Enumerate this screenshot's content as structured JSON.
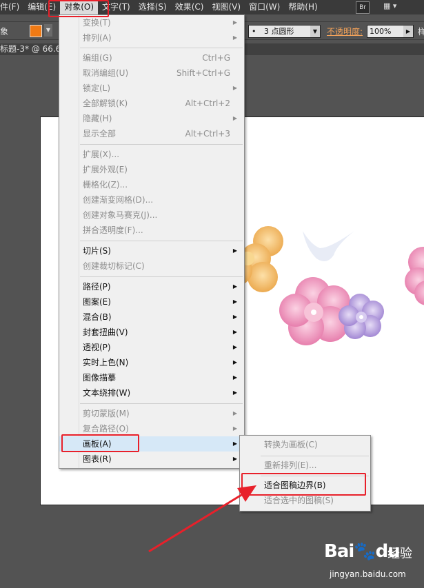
{
  "menubar": {
    "items": [
      "件(F)",
      "编辑(E)",
      "对象(O)",
      "文字(T)",
      "选择(S)",
      "效果(C)",
      "视图(V)",
      "窗口(W)",
      "帮助(H)"
    ],
    "br_label": "Br"
  },
  "controlbar": {
    "object_label": "象",
    "stroke_profile": "3 点圆形",
    "opacity_label": "不透明度:",
    "opacity_value": "100%",
    "style_label": "样"
  },
  "document_tab": {
    "title": "标题-3* @ 66.6"
  },
  "object_menu": {
    "items": [
      {
        "label": "变换(T)",
        "shortcut": "",
        "submenu": true,
        "enabled": false
      },
      {
        "label": "排列(A)",
        "shortcut": "",
        "submenu": true,
        "enabled": false
      },
      {
        "label": "编组(G)",
        "shortcut": "Ctrl+G",
        "submenu": false,
        "enabled": false
      },
      {
        "label": "取消编组(U)",
        "shortcut": "Shift+Ctrl+G",
        "submenu": false,
        "enabled": false
      },
      {
        "label": "锁定(L)",
        "shortcut": "",
        "submenu": true,
        "enabled": false
      },
      {
        "label": "全部解锁(K)",
        "shortcut": "Alt+Ctrl+2",
        "submenu": false,
        "enabled": false
      },
      {
        "label": "隐藏(H)",
        "shortcut": "",
        "submenu": true,
        "enabled": false
      },
      {
        "label": "显示全部",
        "shortcut": "Alt+Ctrl+3",
        "submenu": false,
        "enabled": false
      },
      {
        "label": "扩展(X)...",
        "shortcut": "",
        "submenu": false,
        "enabled": false
      },
      {
        "label": "扩展外观(E)",
        "shortcut": "",
        "submenu": false,
        "enabled": false
      },
      {
        "label": "栅格化(Z)...",
        "shortcut": "",
        "submenu": false,
        "enabled": false
      },
      {
        "label": "创建渐变网格(D)...",
        "shortcut": "",
        "submenu": false,
        "enabled": false
      },
      {
        "label": "创建对象马赛克(J)...",
        "shortcut": "",
        "submenu": false,
        "enabled": false
      },
      {
        "label": "拼合透明度(F)...",
        "shortcut": "",
        "submenu": false,
        "enabled": false
      },
      {
        "label": "切片(S)",
        "shortcut": "",
        "submenu": true,
        "enabled": true
      },
      {
        "label": "创建裁切标记(C)",
        "shortcut": "",
        "submenu": false,
        "enabled": false
      },
      {
        "label": "路径(P)",
        "shortcut": "",
        "submenu": true,
        "enabled": true
      },
      {
        "label": "图案(E)",
        "shortcut": "",
        "submenu": true,
        "enabled": true
      },
      {
        "label": "混合(B)",
        "shortcut": "",
        "submenu": true,
        "enabled": true
      },
      {
        "label": "封套扭曲(V)",
        "shortcut": "",
        "submenu": true,
        "enabled": true
      },
      {
        "label": "透视(P)",
        "shortcut": "",
        "submenu": true,
        "enabled": true
      },
      {
        "label": "实时上色(N)",
        "shortcut": "",
        "submenu": true,
        "enabled": true
      },
      {
        "label": "图像描摹",
        "shortcut": "",
        "submenu": true,
        "enabled": true
      },
      {
        "label": "文本绕排(W)",
        "shortcut": "",
        "submenu": true,
        "enabled": true
      },
      {
        "label": "剪切蒙版(M)",
        "shortcut": "",
        "submenu": true,
        "enabled": false
      },
      {
        "label": "复合路径(O)",
        "shortcut": "",
        "submenu": true,
        "enabled": false
      },
      {
        "label": "画板(A)",
        "shortcut": "",
        "submenu": true,
        "enabled": true
      },
      {
        "label": "图表(R)",
        "shortcut": "",
        "submenu": true,
        "enabled": true
      }
    ]
  },
  "artboard_submenu": {
    "items": [
      {
        "label": "转换为画板(C)",
        "enabled": false
      },
      {
        "label": "重新排列(E)...",
        "enabled": false
      },
      {
        "label": "适合图稿边界(B)",
        "enabled": true
      },
      {
        "label": "适合选中的图稿(S)",
        "enabled": false
      }
    ]
  },
  "watermark": {
    "brand": "Bai",
    "brand_mid": "du",
    "jingyan": "经验",
    "url": "jingyan.baidu.com"
  },
  "colors": {
    "accent_red": "#e8202a",
    "menu_highlight": "#d6e8f7",
    "fill_swatch": "#f07a14"
  }
}
